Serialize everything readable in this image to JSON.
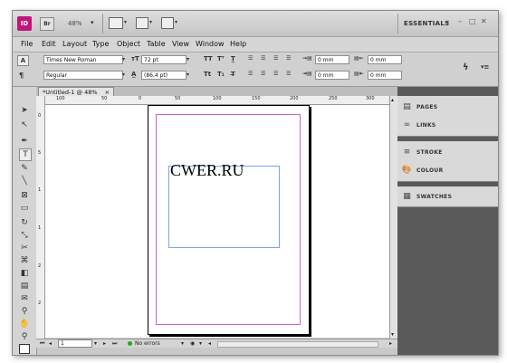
{
  "app": {
    "icon_label": "ID",
    "bridge_label": "Br",
    "zoom": "48%",
    "workspace": "ESSENTIALS"
  },
  "window_controls": {
    "minimize": "–",
    "maximize": "□",
    "close": "✕"
  },
  "menus": [
    "File",
    "Edit",
    "Layout",
    "Type",
    "Object",
    "Table",
    "View",
    "Window",
    "Help"
  ],
  "control": {
    "font_family": "Times New Roman",
    "font_style": "Regular",
    "font_size": "72 pt",
    "leading": "(86,4 pt)",
    "indent_1": "0 mm",
    "indent_2": "0 mm",
    "indent_3": "0 mm",
    "indent_4": "0 mm",
    "indent_5": "0 mm",
    "indent_6": "0 mm"
  },
  "document": {
    "tab_title": "*Untitled-1 @ 48%",
    "tab_close": "×",
    "frame_text": "CWER.RU"
  },
  "ruler": {
    "h": [
      "100",
      "50",
      "0",
      "50",
      "100",
      "150",
      "200",
      "250",
      "300"
    ],
    "v": [
      "0",
      "5",
      "1",
      "1",
      "2",
      "2"
    ]
  },
  "status": {
    "page": "1",
    "preflight": "No errors"
  },
  "panels": [
    {
      "name": "PAGES",
      "icon": "pages-icon"
    },
    {
      "name": "LINKS",
      "icon": "links-icon"
    },
    {
      "name": "STROKE",
      "icon": "stroke-icon"
    },
    {
      "name": "COLOUR",
      "icon": "colour-icon"
    },
    {
      "name": "SWATCHES",
      "icon": "swatches-icon"
    }
  ],
  "colors": {
    "app_icon": "#c0157a",
    "margin_guide": "#d25dd2",
    "frame_edge": "#7aa4e6",
    "panel_dark": "#5a5a5a"
  }
}
